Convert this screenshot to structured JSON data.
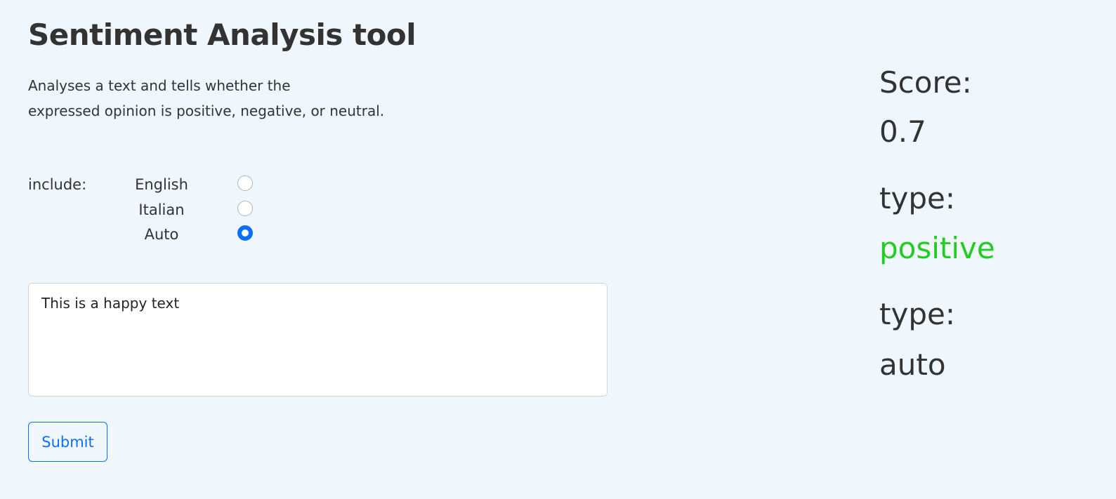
{
  "header": {
    "title": "Sentiment Analysis tool",
    "description_line1": "Analyses a text and tells whether the",
    "description_line2": "expressed opinion is positive, negative, or neutral."
  },
  "form": {
    "include_label": "include:",
    "languages": [
      {
        "label": "English",
        "checked": false
      },
      {
        "label": "Italian",
        "checked": false
      },
      {
        "label": "Auto",
        "checked": true
      }
    ],
    "text_value": "This is a happy text",
    "submit_label": "Submit"
  },
  "results": {
    "score_label": "Score:",
    "score_value": "0.7",
    "type_label": "type:",
    "type_value": "positive",
    "lang_type_label": "type:",
    "lang_type_value": "auto"
  },
  "colors": {
    "background": "#eff7fd",
    "accent": "#0d6efd",
    "positive": "#22cc22"
  }
}
